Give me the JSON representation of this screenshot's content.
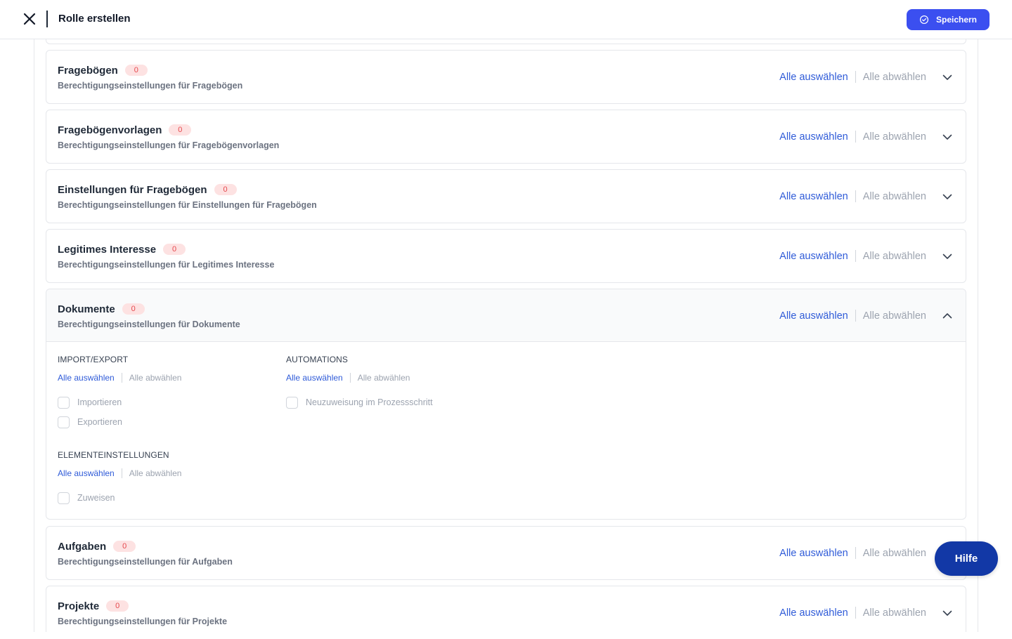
{
  "header": {
    "title": "Rolle erstellen",
    "save_label": "Speichern"
  },
  "cards": [
    {
      "title": "Fragebögen",
      "badge": "0",
      "subtitle": "Berechtigungseinstellungen für Fragebögen",
      "select_all": "Alle auswählen",
      "deselect_all": "Alle abwählen",
      "expanded": false
    },
    {
      "title": "Fragebögenvorlagen",
      "badge": "0",
      "subtitle": "Berechtigungseinstellungen für Fragebögenvorlagen",
      "select_all": "Alle auswählen",
      "deselect_all": "Alle abwählen",
      "expanded": false
    },
    {
      "title": "Einstellungen für Fragebögen",
      "badge": "0",
      "subtitle": "Berechtigungseinstellungen für Einstellungen für Fragebögen",
      "select_all": "Alle auswählen",
      "deselect_all": "Alle abwählen",
      "expanded": false
    },
    {
      "title": "Legitimes Interesse",
      "badge": "0",
      "subtitle": "Berechtigungseinstellungen für Legitimes Interesse",
      "select_all": "Alle auswählen",
      "deselect_all": "Alle abwählen",
      "expanded": false
    },
    {
      "title": "Dokumente",
      "badge": "0",
      "subtitle": "Berechtigungseinstellungen für Dokumente",
      "select_all": "Alle auswählen",
      "deselect_all": "Alle abwählen",
      "expanded": true,
      "groups": [
        {
          "title": "IMPORT/EXPORT",
          "select_all": "Alle auswählen",
          "deselect_all": "Alle abwählen",
          "options": [
            {
              "label": "Importieren",
              "checked": false
            },
            {
              "label": "Exportieren",
              "checked": false
            }
          ]
        },
        {
          "title": "AUTOMATIONS",
          "select_all": "Alle auswählen",
          "deselect_all": "Alle abwählen",
          "options": [
            {
              "label": "Neuzuweisung im Prozessschritt",
              "checked": false
            }
          ]
        },
        {
          "title": "ELEMENTEINSTELLUNGEN",
          "select_all": "Alle auswählen",
          "deselect_all": "Alle abwählen",
          "options": [
            {
              "label": "Zuweisen",
              "checked": false
            }
          ]
        }
      ]
    },
    {
      "title": "Aufgaben",
      "badge": "0",
      "subtitle": "Berechtigungseinstellungen für Aufgaben",
      "select_all": "Alle auswählen",
      "deselect_all": "Alle abwählen",
      "expanded": false
    },
    {
      "title": "Projekte",
      "badge": "0",
      "subtitle": "Berechtigungseinstellungen für Projekte",
      "select_all": "Alle auswählen",
      "deselect_all": "Alle abwählen",
      "expanded": false
    }
  ],
  "help": {
    "label": "Hilfe"
  },
  "colors": {
    "primary": "#3b4ff0",
    "link": "#2f5bd8",
    "badge_bg": "#fde2e2",
    "badge_text": "#e5484d",
    "help_bg": "#1238a6"
  },
  "icons": {
    "close": "close-icon",
    "save": "check-circle-icon",
    "collapsed": "chevron-down-icon",
    "expanded": "chevron-up-icon"
  }
}
